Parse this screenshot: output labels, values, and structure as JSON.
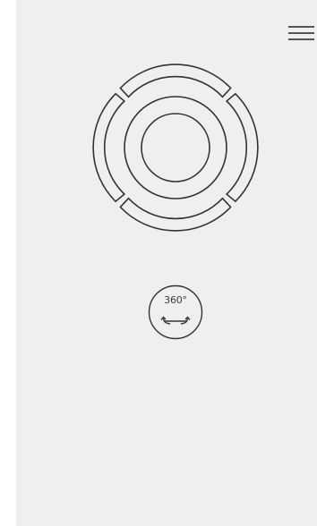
{
  "menu": {
    "icon": "hamburger-menu-icon"
  },
  "joystick": {
    "icon": "directional-pad-icon",
    "segments": [
      "up",
      "right",
      "down",
      "left"
    ],
    "center": "center-knob"
  },
  "rotate": {
    "icon": "rotate-360-icon",
    "label": "360°"
  },
  "colors": {
    "background": "#efefef",
    "stroke": "#333333"
  }
}
